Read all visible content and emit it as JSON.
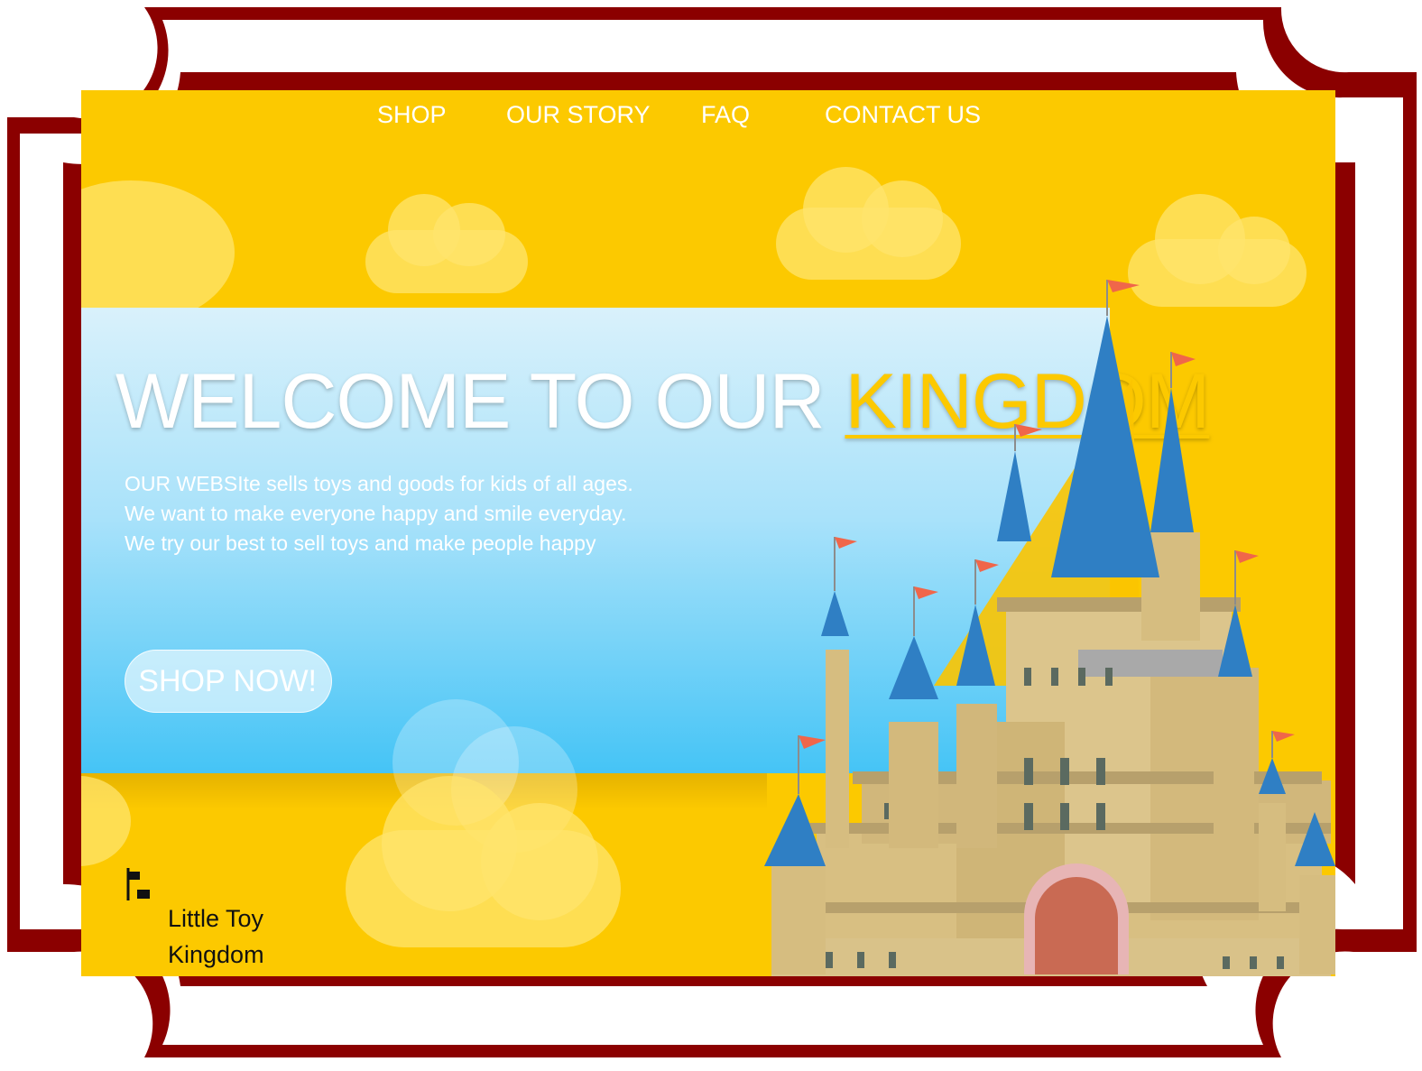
{
  "nav": {
    "items": [
      {
        "label": "SHOP"
      },
      {
        "label": "OUR STORY"
      },
      {
        "label": "FAQ"
      },
      {
        "label": "CONTACT US"
      }
    ]
  },
  "hero": {
    "title_main": "WELCOME TO OUR ",
    "title_accent": "KINGDOM",
    "body_lines": [
      "OUR WEBSIte sells toys and goods for kids of all ages.",
      "We want to make everyone happy and smile everyday.",
      "We try our best to sell toys and make people happy"
    ],
    "cta_label": "SHOP NOW!"
  },
  "logo": {
    "line1": "Little Toy",
    "line2": "Kingdom",
    "icon": "flag-icon"
  },
  "colors": {
    "frame": "#8b0000",
    "page_background": "#fcc900",
    "banner_top": "#d9f1fb",
    "banner_bottom": "#45c4f6",
    "accent": "#fcc900",
    "castle_roof": "#2f7fc4",
    "castle_wall": "#d9c289",
    "flag": "#f0664a"
  },
  "illustration": {
    "name": "castle-illustration",
    "icon": "castle-icon"
  }
}
